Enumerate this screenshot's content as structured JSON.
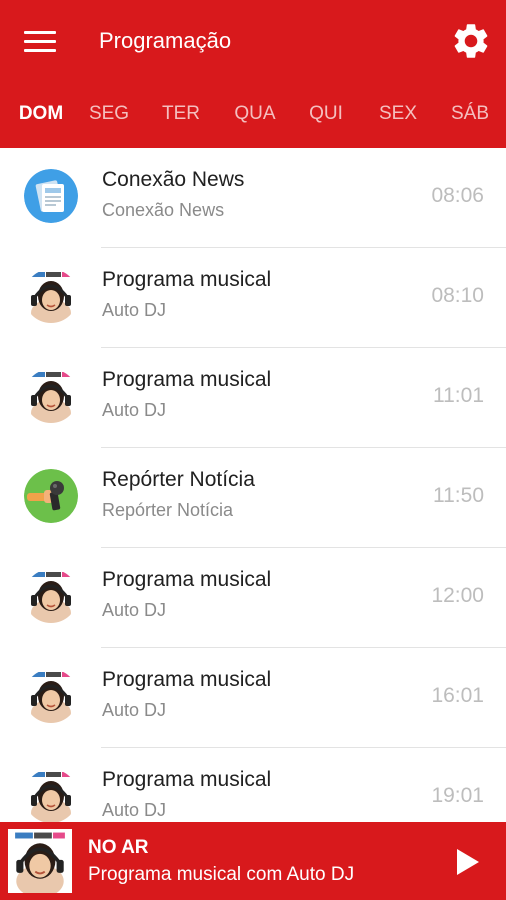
{
  "header": {
    "title": "Programação",
    "menu_icon": "hamburger-menu-icon",
    "settings_icon": "gear-icon",
    "background_color": "#d8191c"
  },
  "days": [
    {
      "label": "DOM",
      "active": true
    },
    {
      "label": "SEG",
      "active": false
    },
    {
      "label": "TER",
      "active": false
    },
    {
      "label": "QUA",
      "active": false
    },
    {
      "label": "QUI",
      "active": false
    },
    {
      "label": "SEX",
      "active": false
    },
    {
      "label": "SÁB",
      "active": false
    }
  ],
  "schedule": [
    {
      "title": "Conexão News",
      "subtitle": "Conexão News",
      "time": "08:06",
      "icon": "newspaper-icon"
    },
    {
      "title": "Programa musical",
      "subtitle": "Auto DJ",
      "time": "08:10",
      "icon": "dj-headphones-avatar"
    },
    {
      "title": "Programa musical",
      "subtitle": "Auto DJ",
      "time": "11:01",
      "icon": "dj-headphones-avatar"
    },
    {
      "title": "Repórter Notícia",
      "subtitle": "Repórter Notícia",
      "time": "11:50",
      "icon": "microphone-icon"
    },
    {
      "title": "Programa musical",
      "subtitle": "Auto DJ",
      "time": "12:00",
      "icon": "dj-headphones-avatar"
    },
    {
      "title": "Programa musical",
      "subtitle": "Auto DJ",
      "time": "16:01",
      "icon": "dj-headphones-avatar"
    },
    {
      "title": "Programa musical",
      "subtitle": "Auto DJ",
      "time": "19:01",
      "icon": "dj-headphones-avatar"
    }
  ],
  "player": {
    "status_label": "NO AR",
    "now_playing": "Programa musical com Auto DJ",
    "play_icon": "play-icon"
  }
}
